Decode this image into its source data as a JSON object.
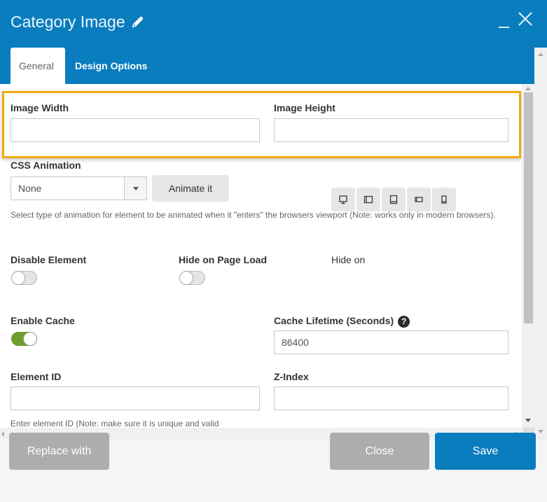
{
  "header": {
    "title": "Category Image",
    "title_icon": "pencil-icon",
    "minimize_icon": "minimize-icon",
    "close_icon": "close-icon"
  },
  "tabs": [
    {
      "label": "General",
      "active": true
    },
    {
      "label": "Design Options",
      "active": false
    }
  ],
  "form": {
    "image_width": {
      "label": "Image Width",
      "value": ""
    },
    "image_height": {
      "label": "Image Height",
      "value": ""
    },
    "css_animation": {
      "label": "CSS Animation",
      "selected": "None",
      "animate_button": "Animate it",
      "help": "Select type of animation for element to be animated when it \"enters\" the browsers viewport (Note: works only in modern browsers)."
    },
    "disable_element": {
      "label": "Disable Element",
      "on": false
    },
    "hide_on_page_load": {
      "label": "Hide on Page Load",
      "on": false
    },
    "hide_on": {
      "label": "Hide on",
      "devices": [
        "desktop-icon",
        "tablet-landscape-icon",
        "tablet-portrait-icon",
        "mobile-landscape-icon",
        "mobile-portrait-icon"
      ]
    },
    "enable_cache": {
      "label": "Enable Cache",
      "on": true
    },
    "cache_lifetime": {
      "label": "Cache Lifetime (Seconds)",
      "value": "86400",
      "help_icon": "question-circle-icon"
    },
    "element_id": {
      "label": "Element ID",
      "value": "",
      "help": "Enter element ID (Note: make sure it is unique and valid"
    },
    "z_index": {
      "label": "Z-Index",
      "value": ""
    }
  },
  "colors": {
    "brand_blue": "#0a7dbf",
    "highlight": "#f2a90f",
    "toggle_on": "#6f9e2f",
    "grey_button": "#adadad"
  },
  "footer": {
    "replace_label": "Replace with",
    "close_label": "Close",
    "save_label": "Save"
  }
}
